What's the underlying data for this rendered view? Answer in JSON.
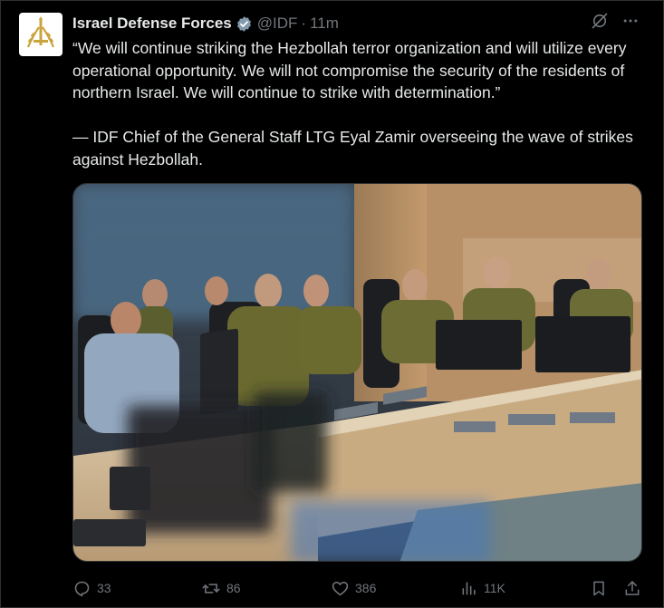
{
  "author": {
    "display_name": "Israel Defense Forces",
    "handle": "@IDF",
    "separator": "·",
    "time": "11m",
    "avatar_icon": "idf-emblem-icon",
    "verified_icon": "verified-badge-icon"
  },
  "header_actions": {
    "grok_icon": "grok-icon",
    "more_icon": "more-icon",
    "more_label": "···"
  },
  "tweet": {
    "paragraph1": "“We will continue striking the Hezbollah terror organization and will utilize every operational opportunity. We will not compromise the security of the residents of northern Israel. We will continue to strike with determination.”",
    "paragraph2": "— IDF Chief of the General Staff LTG Eyal Zamir overseeing the wave of strikes against Hezbollah."
  },
  "media": {
    "kind": "photo"
  },
  "actions": {
    "replies": "33",
    "reposts": "86",
    "likes": "386",
    "views": "11K",
    "reply_icon": "reply-icon",
    "repost_icon": "repost-icon",
    "like_icon": "heart-icon",
    "views_icon": "views-icon",
    "bookmark_icon": "bookmark-icon",
    "share_icon": "share-icon"
  },
  "colors": {
    "background": "#000000",
    "text": "#e7e9ea",
    "muted": "#71767b",
    "border": "#2f3336",
    "verified": "#829aab"
  }
}
